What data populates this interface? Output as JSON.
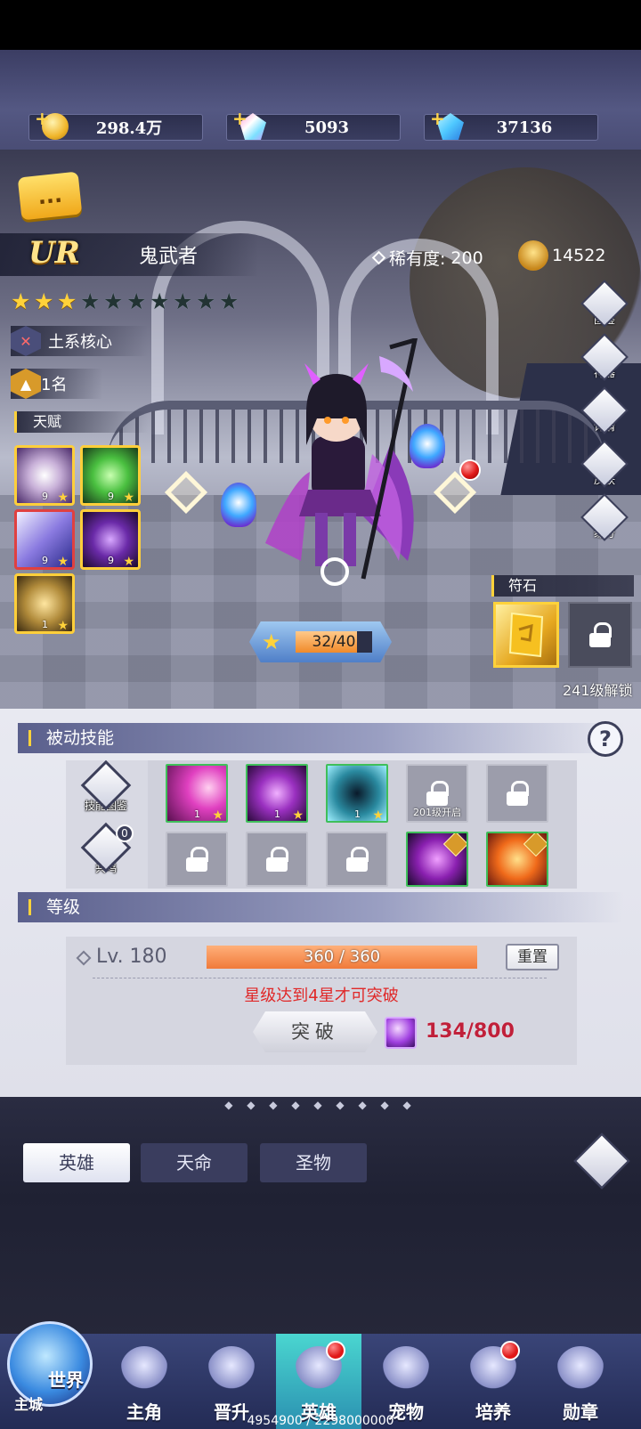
{
  "currencies": [
    {
      "icon": "gold-coin-icon",
      "value": "298.4万"
    },
    {
      "icon": "rainbow-diamond-icon",
      "value": "5093"
    },
    {
      "icon": "blue-diamond-icon",
      "value": "37136"
    }
  ],
  "hero": {
    "rarity_badge": "UR",
    "name": "鬼武者",
    "rarity_label": "稀有度:",
    "rarity_value": "200",
    "power": "14522",
    "stars_total": 10,
    "stars_filled": 3,
    "role": "土系核心",
    "rank": "1名",
    "chat_icon": "..."
  },
  "talents": {
    "label": "天赋",
    "items": [
      {
        "name": "skull-talent-icon",
        "level": "9"
      },
      {
        "name": "green-skull-talent-icon",
        "level": "9"
      },
      {
        "name": "wind-talent-icon",
        "level": "9"
      },
      {
        "name": "demon-talent-icon",
        "level": "9"
      },
      {
        "name": "axe-talent-icon",
        "level": "1"
      }
    ]
  },
  "side_menu": [
    "图鉴",
    "神器",
    "详情",
    "皮肤",
    "缘分"
  ],
  "exp": {
    "text": "32/40",
    "current": 32,
    "max": 40
  },
  "rune": {
    "label": "符石",
    "lock_text": "241级解锁"
  },
  "passive_skills": {
    "title": "被动技能",
    "help": "?",
    "codex_label": "技能图鉴",
    "resonance_label": "共鸣",
    "resonance_count": "0",
    "row1": [
      {
        "state": "unlocked",
        "level": "1",
        "name": "pink-slash-skill-icon"
      },
      {
        "state": "unlocked",
        "level": "1",
        "name": "purple-claw-skill-icon"
      },
      {
        "state": "unlocked",
        "level": "1",
        "name": "shatter-skill-icon"
      },
      {
        "state": "locked",
        "caption": "201级开启"
      },
      {
        "state": "locked",
        "caption": ""
      }
    ],
    "row2": [
      {
        "state": "locked"
      },
      {
        "state": "locked"
      },
      {
        "state": "locked"
      },
      {
        "state": "preview",
        "name": "purple-blade-skill-icon",
        "badge": "讨"
      },
      {
        "state": "preview",
        "name": "fire-fox-skill-icon",
        "badge": "讨"
      }
    ]
  },
  "level": {
    "title": "等级",
    "lv_text": "Lv. 180",
    "exp_text": "360 / 360",
    "exp_current": 360,
    "exp_max": 360,
    "reset_label": "重置",
    "note": "星级达到4星才可突破",
    "break_label": "突破",
    "material_count": "134/800"
  },
  "tabs": [
    {
      "label": "英雄",
      "active": true
    },
    {
      "label": "天命",
      "active": false
    },
    {
      "label": "圣物",
      "active": false
    }
  ],
  "nav": {
    "world": {
      "label": "世界",
      "sub": "主城"
    },
    "items": [
      {
        "label": "主角",
        "active": false,
        "dot": false,
        "icon": "hero-bust-icon"
      },
      {
        "label": "晋升",
        "active": false,
        "dot": false,
        "icon": "wings-icon"
      },
      {
        "label": "英雄",
        "active": true,
        "dot": true,
        "icon": "helmet-icon"
      },
      {
        "label": "宠物",
        "active": false,
        "dot": false,
        "icon": "beast-icon"
      },
      {
        "label": "培养",
        "active": false,
        "dot": true,
        "icon": "gem-star-icon"
      },
      {
        "label": "勋章",
        "active": false,
        "dot": false,
        "icon": "medal-icon"
      }
    ]
  },
  "footer": "4954900 / 2298000000",
  "colors": {
    "gold": "#ffd23a",
    "red_note": "#e02828",
    "panel_bg": "#e8e9f1",
    "nav_bg": "#2e3a6e"
  }
}
